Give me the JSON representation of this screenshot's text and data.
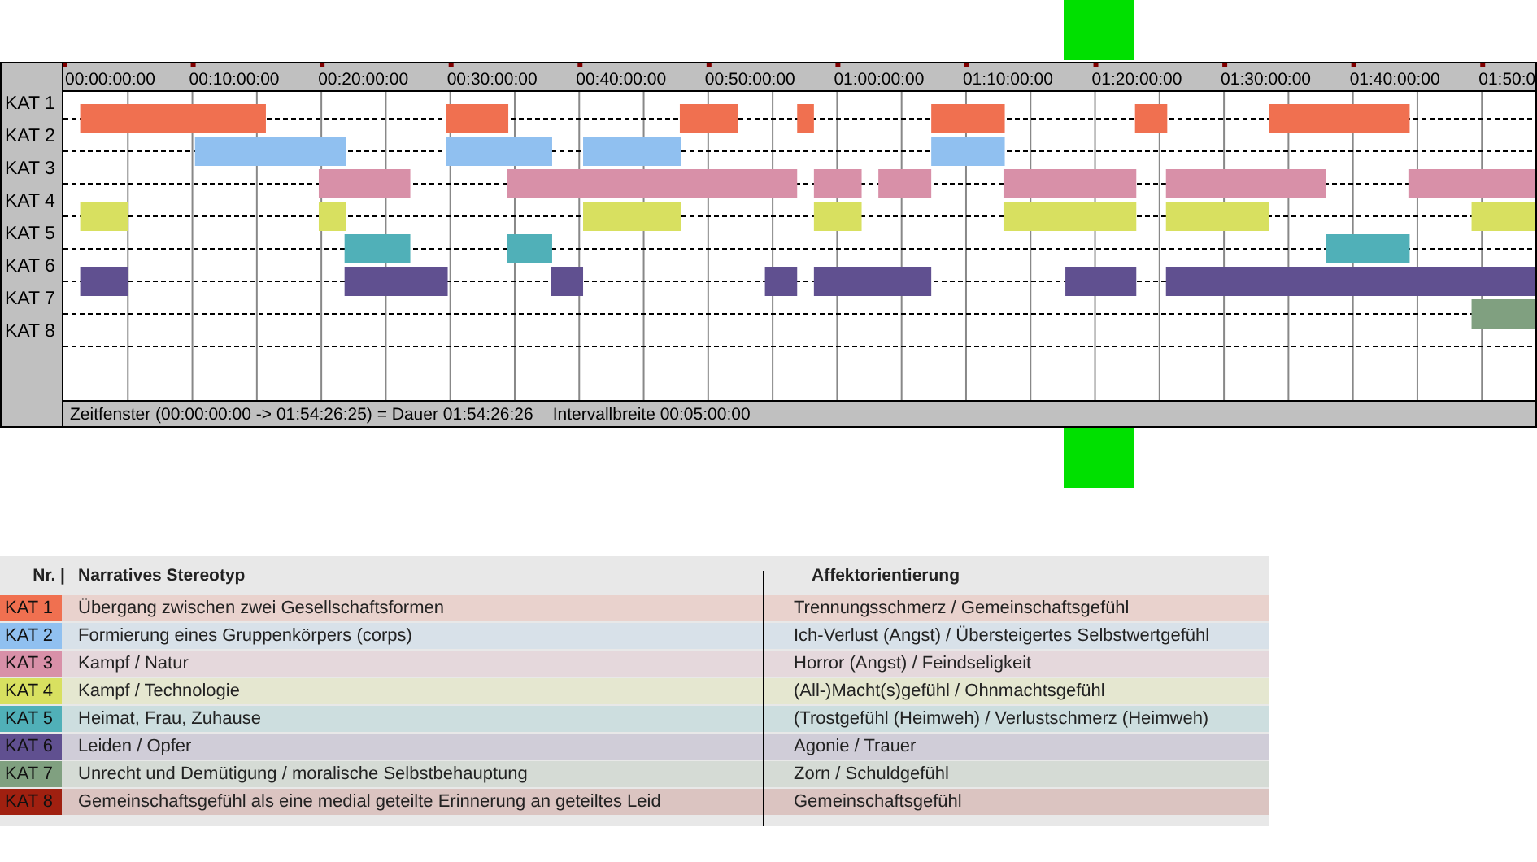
{
  "timeline": {
    "ticks": [
      "00:00:00:00",
      "00:10:00:00",
      "00:20:00:00",
      "00:30:00:00",
      "00:40:00:00",
      "00:50:00:00",
      "01:00:00:00",
      "01:10:00:00",
      "01:20:00:00",
      "01:30:00:00",
      "01:40:00:00",
      "01:50:0"
    ],
    "rows": [
      "KAT 1",
      "KAT 2",
      "KAT 3",
      "KAT 4",
      "KAT 5",
      "KAT 6",
      "KAT 7",
      "KAT 8"
    ],
    "status": [
      "Zeitfenster (00:00:00:00 -> 01:54:26:25) = Dauer 01:54:26:26",
      "Intervallbreite 00:05:00:00"
    ]
  },
  "legend": {
    "columns": [
      "Nr. |",
      "Narratives Stereotyp",
      "Affektorientierung"
    ],
    "rows": [
      {
        "nr": "KAT 1",
        "color": "#f07050",
        "stereotype": "Übergang zwischen zwei Gesellschaftsformen",
        "affect": "Trennungsschmerz / Gemeinschaftsgefühl"
      },
      {
        "nr": "KAT 2",
        "color": "#90c0f0",
        "stereotype": "Formierung eines Gruppenkörpers (corps)",
        "affect": "Ich-Verlust (Angst) / Übersteigertes Selbstwertgefühl"
      },
      {
        "nr": "KAT 3",
        "color": "#d890a8",
        "stereotype": "Kampf / Natur",
        "affect": "Horror (Angst) / Feindseligkeit"
      },
      {
        "nr": "KAT 4",
        "color": "#d8e060",
        "stereotype": "Kampf / Technologie",
        "affect": "(All-)Macht(s)gefühl / Ohnmachtsgefühl"
      },
      {
        "nr": "KAT 5",
        "color": "#50b0b8",
        "stereotype": "Heimat, Frau, Zuhause",
        "affect": "(Trostgefühl (Heimweh) / Verlustschmerz (Heimweh)"
      },
      {
        "nr": "KAT 6",
        "color": "#605090",
        "stereotype": "Leiden / Opfer",
        "affect": "Agonie / Trauer"
      },
      {
        "nr": "KAT 7",
        "color": "#80a080",
        "stereotype": "Unrecht und Demütigung / moralische Selbstbehauptung",
        "affect": "Zorn / Schuldgefühl"
      },
      {
        "nr": "KAT 8",
        "color": "#a02010",
        "stereotype": "Gemeinschaftsgefühl als eine medial geteilte Erinnerung an geteiltes Leid",
        "affect": "Gemeinschaftsgefühl"
      }
    ]
  }
}
